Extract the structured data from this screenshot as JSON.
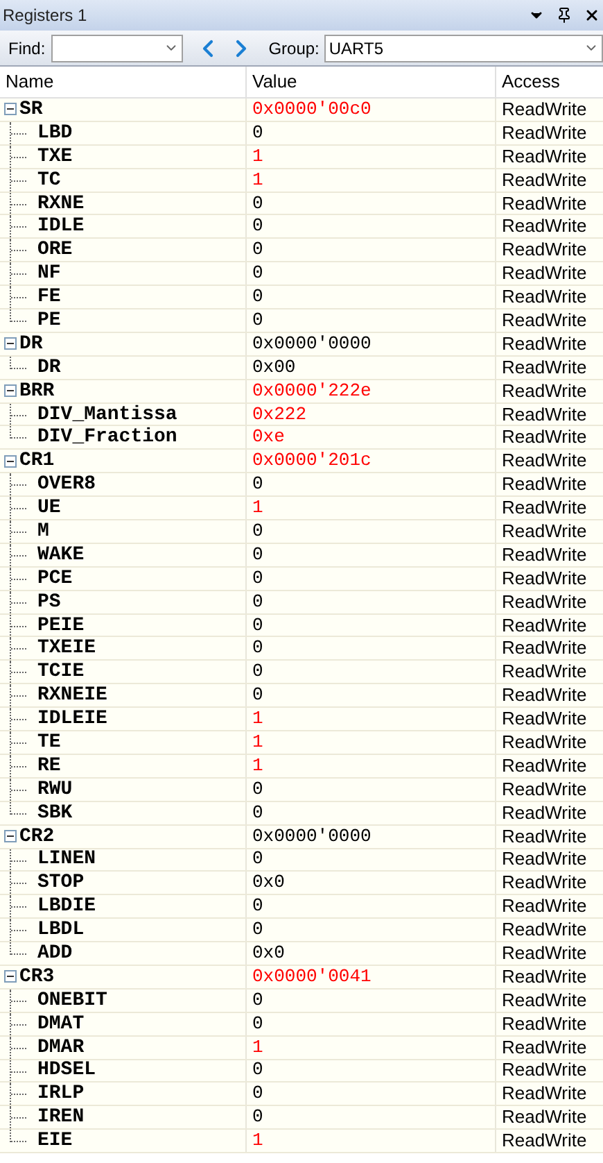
{
  "window": {
    "title": "Registers 1"
  },
  "toolbar": {
    "find_label": "Find:",
    "group_label": "Group:",
    "group_value": "UART5"
  },
  "table": {
    "columns": [
      "Name",
      "Value",
      "Access"
    ],
    "rows": [
      {
        "name": "SR",
        "value": "0x0000'00c0",
        "access": "ReadWrite",
        "changed": true,
        "expanded": true,
        "children": [
          {
            "name": "LBD",
            "value": "0",
            "access": "ReadWrite",
            "changed": false
          },
          {
            "name": "TXE",
            "value": "1",
            "access": "ReadWrite",
            "changed": true
          },
          {
            "name": "TC",
            "value": "1",
            "access": "ReadWrite",
            "changed": true
          },
          {
            "name": "RXNE",
            "value": "0",
            "access": "ReadWrite",
            "changed": false
          },
          {
            "name": "IDLE",
            "value": "0",
            "access": "ReadWrite",
            "changed": false
          },
          {
            "name": "ORE",
            "value": "0",
            "access": "ReadWrite",
            "changed": false
          },
          {
            "name": "NF",
            "value": "0",
            "access": "ReadWrite",
            "changed": false
          },
          {
            "name": "FE",
            "value": "0",
            "access": "ReadWrite",
            "changed": false
          },
          {
            "name": "PE",
            "value": "0",
            "access": "ReadWrite",
            "changed": false
          }
        ]
      },
      {
        "name": "DR",
        "value": "0x0000'0000",
        "access": "ReadWrite",
        "changed": false,
        "expanded": true,
        "children": [
          {
            "name": "DR",
            "value": "0x00",
            "access": "ReadWrite",
            "changed": false
          }
        ]
      },
      {
        "name": "BRR",
        "value": "0x0000'222e",
        "access": "ReadWrite",
        "changed": true,
        "expanded": true,
        "children": [
          {
            "name": "DIV_Mantissa",
            "value": "0x222",
            "access": "ReadWrite",
            "changed": true
          },
          {
            "name": "DIV_Fraction",
            "value": "0xe",
            "access": "ReadWrite",
            "changed": true
          }
        ]
      },
      {
        "name": "CR1",
        "value": "0x0000'201c",
        "access": "ReadWrite",
        "changed": true,
        "expanded": true,
        "children": [
          {
            "name": "OVER8",
            "value": "0",
            "access": "ReadWrite",
            "changed": false
          },
          {
            "name": "UE",
            "value": "1",
            "access": "ReadWrite",
            "changed": true
          },
          {
            "name": "M",
            "value": "0",
            "access": "ReadWrite",
            "changed": false
          },
          {
            "name": "WAKE",
            "value": "0",
            "access": "ReadWrite",
            "changed": false
          },
          {
            "name": "PCE",
            "value": "0",
            "access": "ReadWrite",
            "changed": false
          },
          {
            "name": "PS",
            "value": "0",
            "access": "ReadWrite",
            "changed": false
          },
          {
            "name": "PEIE",
            "value": "0",
            "access": "ReadWrite",
            "changed": false
          },
          {
            "name": "TXEIE",
            "value": "0",
            "access": "ReadWrite",
            "changed": false
          },
          {
            "name": "TCIE",
            "value": "0",
            "access": "ReadWrite",
            "changed": false
          },
          {
            "name": "RXNEIE",
            "value": "0",
            "access": "ReadWrite",
            "changed": false
          },
          {
            "name": "IDLEIE",
            "value": "1",
            "access": "ReadWrite",
            "changed": true
          },
          {
            "name": "TE",
            "value": "1",
            "access": "ReadWrite",
            "changed": true
          },
          {
            "name": "RE",
            "value": "1",
            "access": "ReadWrite",
            "changed": true
          },
          {
            "name": "RWU",
            "value": "0",
            "access": "ReadWrite",
            "changed": false
          },
          {
            "name": "SBK",
            "value": "0",
            "access": "ReadWrite",
            "changed": false
          }
        ]
      },
      {
        "name": "CR2",
        "value": "0x0000'0000",
        "access": "ReadWrite",
        "changed": false,
        "expanded": true,
        "children": [
          {
            "name": "LINEN",
            "value": "0",
            "access": "ReadWrite",
            "changed": false
          },
          {
            "name": "STOP",
            "value": "0x0",
            "access": "ReadWrite",
            "changed": false
          },
          {
            "name": "LBDIE",
            "value": "0",
            "access": "ReadWrite",
            "changed": false
          },
          {
            "name": "LBDL",
            "value": "0",
            "access": "ReadWrite",
            "changed": false
          },
          {
            "name": "ADD",
            "value": "0x0",
            "access": "ReadWrite",
            "changed": false
          }
        ]
      },
      {
        "name": "CR3",
        "value": "0x0000'0041",
        "access": "ReadWrite",
        "changed": true,
        "expanded": true,
        "children": [
          {
            "name": "ONEBIT",
            "value": "0",
            "access": "ReadWrite",
            "changed": false
          },
          {
            "name": "DMAT",
            "value": "0",
            "access": "ReadWrite",
            "changed": false
          },
          {
            "name": "DMAR",
            "value": "1",
            "access": "ReadWrite",
            "changed": true
          },
          {
            "name": "HDSEL",
            "value": "0",
            "access": "ReadWrite",
            "changed": false
          },
          {
            "name": "IRLP",
            "value": "0",
            "access": "ReadWrite",
            "changed": false
          },
          {
            "name": "IREN",
            "value": "0",
            "access": "ReadWrite",
            "changed": false
          },
          {
            "name": "EIE",
            "value": "1",
            "access": "ReadWrite",
            "changed": true
          }
        ]
      }
    ]
  }
}
